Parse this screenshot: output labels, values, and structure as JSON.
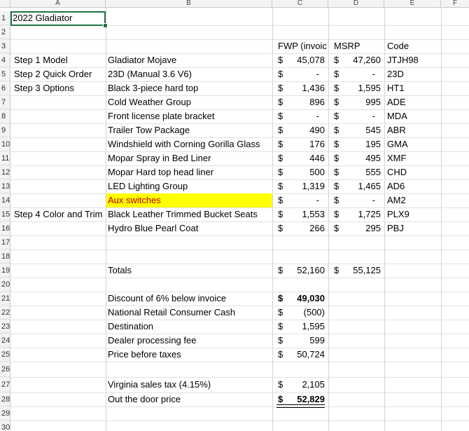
{
  "columns": [
    "A",
    "B",
    "C",
    "D",
    "E",
    "F"
  ],
  "row_numbers": [
    "1",
    "2",
    "3",
    "4",
    "5",
    "6",
    "7",
    "8",
    "9",
    "10",
    "11",
    "12",
    "13",
    "14",
    "15",
    "16",
    "17",
    "18",
    "19",
    "20",
    "21",
    "22",
    "23",
    "24",
    "25",
    "26",
    "27",
    "28",
    "29",
    "30"
  ],
  "a1": "2022 Gladiator",
  "headers": {
    "c": "FWP (invoic",
    "d": "MSRP",
    "e": "Code"
  },
  "steps": {
    "s1": "Step 1 Model",
    "s2": "Step 2 Quick Order",
    "s3": "Step 3 Options",
    "s4": "Step 4 Color and Trim"
  },
  "dollar_sign": "$",
  "items": [
    {
      "name": "Gladiator Mojave",
      "fwp": "45,078",
      "msrp": "47,260",
      "code": "JTJH98"
    },
    {
      "name": "23D (Manual 3.6 V6)",
      "fwp": "-",
      "msrp": "-",
      "code": "23D"
    },
    {
      "name": "Black 3-piece hard top",
      "fwp": "1,436",
      "msrp": "1,595",
      "code": "HT1"
    },
    {
      "name": "Cold Weather Group",
      "fwp": "896",
      "msrp": "995",
      "code": "ADE"
    },
    {
      "name": "Front license plate bracket",
      "fwp": "-",
      "msrp": "-",
      "code": "MDA"
    },
    {
      "name": "Trailer Tow Package",
      "fwp": "490",
      "msrp": "545",
      "code": "ABR"
    },
    {
      "name": "Windshield with Corning Gorilla Glass",
      "fwp": "176",
      "msrp": "195",
      "code": "GMA"
    },
    {
      "name": "Mopar Spray in Bed Liner",
      "fwp": "446",
      "msrp": "495",
      "code": "XMF"
    },
    {
      "name": "Mopar Hard top head liner",
      "fwp": "500",
      "msrp": "555",
      "code": "CHD"
    },
    {
      "name": "LED Lighting Group",
      "fwp": "1,319",
      "msrp": "1,465",
      "code": "AD6"
    },
    {
      "name": "Aux switches",
      "fwp": "-",
      "msrp": "-",
      "code": "AM2"
    },
    {
      "name": "Black Leather Trimmed Bucket Seats",
      "fwp": "1,553",
      "msrp": "1,725",
      "code": "PLX9"
    },
    {
      "name": "Hydro Blue Pearl Coat",
      "fwp": "266",
      "msrp": "295",
      "code": "PBJ"
    }
  ],
  "totals": {
    "label": "Totals",
    "fwp": "52,160",
    "msrp": "55,125"
  },
  "summary": [
    {
      "label": "Discount of 6% below invoice",
      "value": "49,030"
    },
    {
      "label": "National Retail Consumer Cash",
      "value": "(500)"
    },
    {
      "label": "Destination",
      "value": "1,595"
    },
    {
      "label": "Dealer processing fee",
      "value": "599"
    },
    {
      "label": "Price before taxes",
      "value": "50,724"
    }
  ],
  "tax": {
    "label": "Virginia sales tax (4.15%)",
    "value": "2,105"
  },
  "otd": {
    "label": "Out the door price",
    "value": "52,829"
  },
  "colors": {
    "highlight_bg": "#ffff00",
    "highlight_text": "#c00000",
    "selection": "#217346"
  }
}
